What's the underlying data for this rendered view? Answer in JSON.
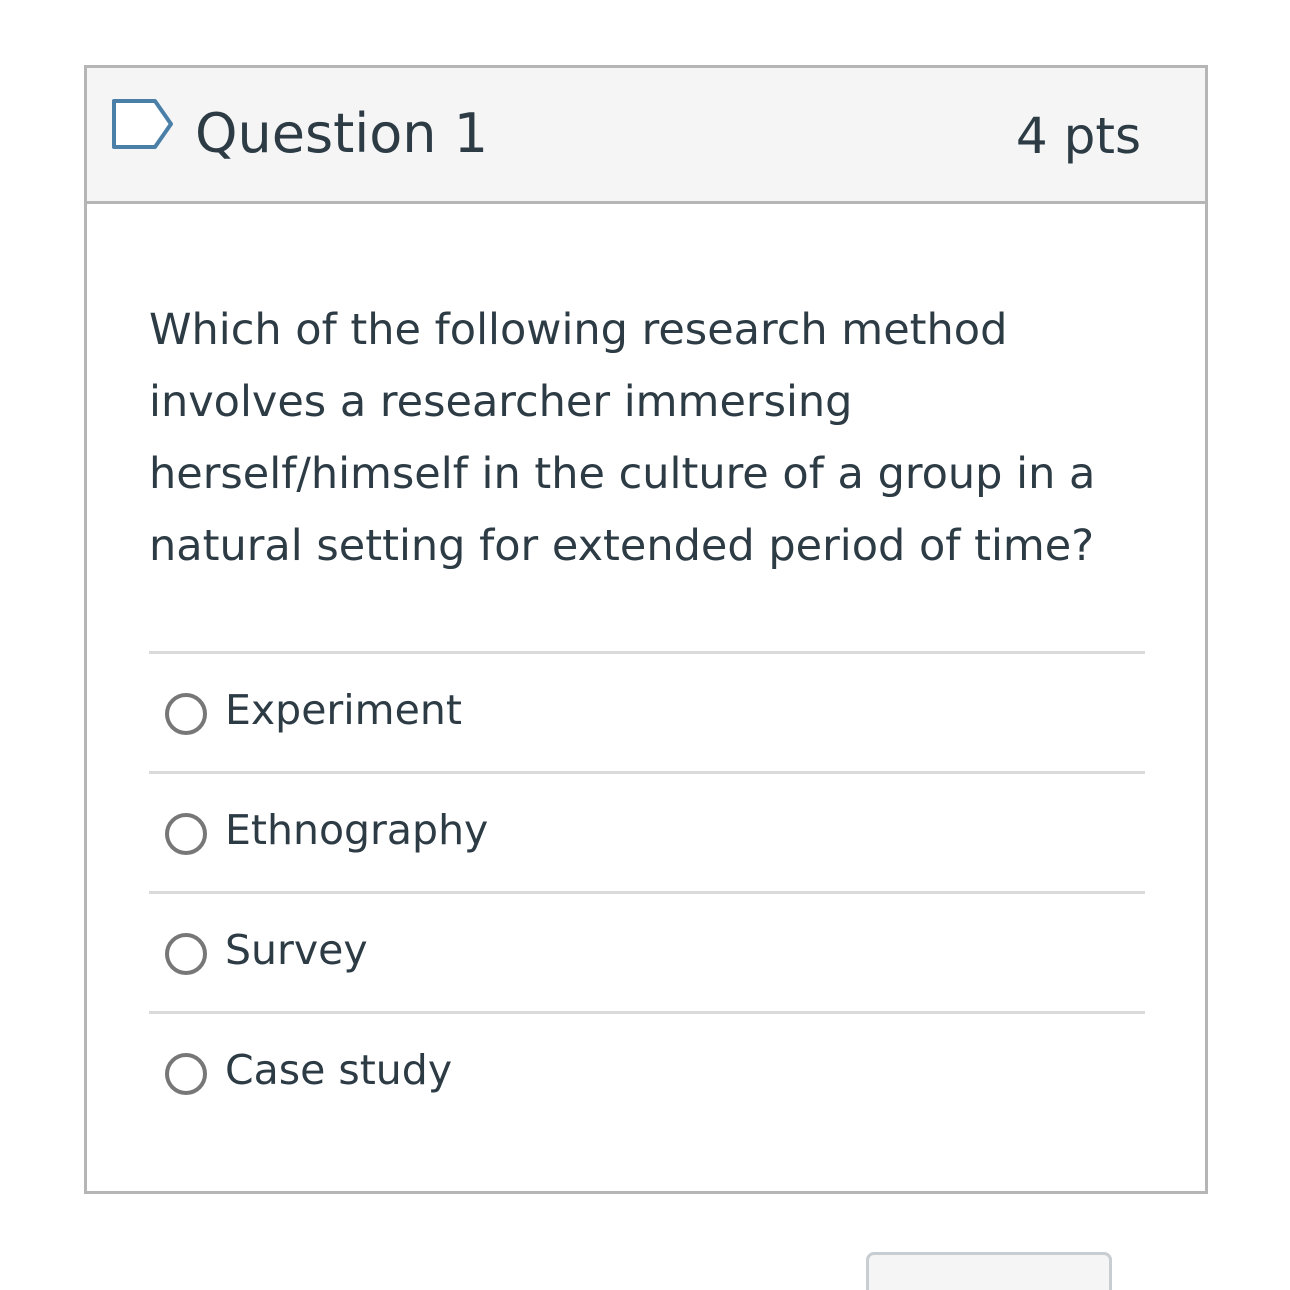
{
  "header": {
    "flag_icon": "flag-outline-icon",
    "title": "Question 1",
    "points": "4 pts"
  },
  "question": {
    "text": "Which of the following research method involves a researcher immersing herself/himself in the culture of a group in a natural setting for extended period of time?"
  },
  "answers": [
    {
      "label": "Experiment",
      "selected": false
    },
    {
      "label": "Ethnography",
      "selected": false
    },
    {
      "label": "Survey",
      "selected": false
    },
    {
      "label": "Case study",
      "selected": false
    }
  ],
  "colors": {
    "text": "#2d3b45",
    "border": "#b5b5b5",
    "header_bg": "#f5f5f5",
    "flag_blue": "#4a7fa8",
    "radio_border": "#777777"
  }
}
